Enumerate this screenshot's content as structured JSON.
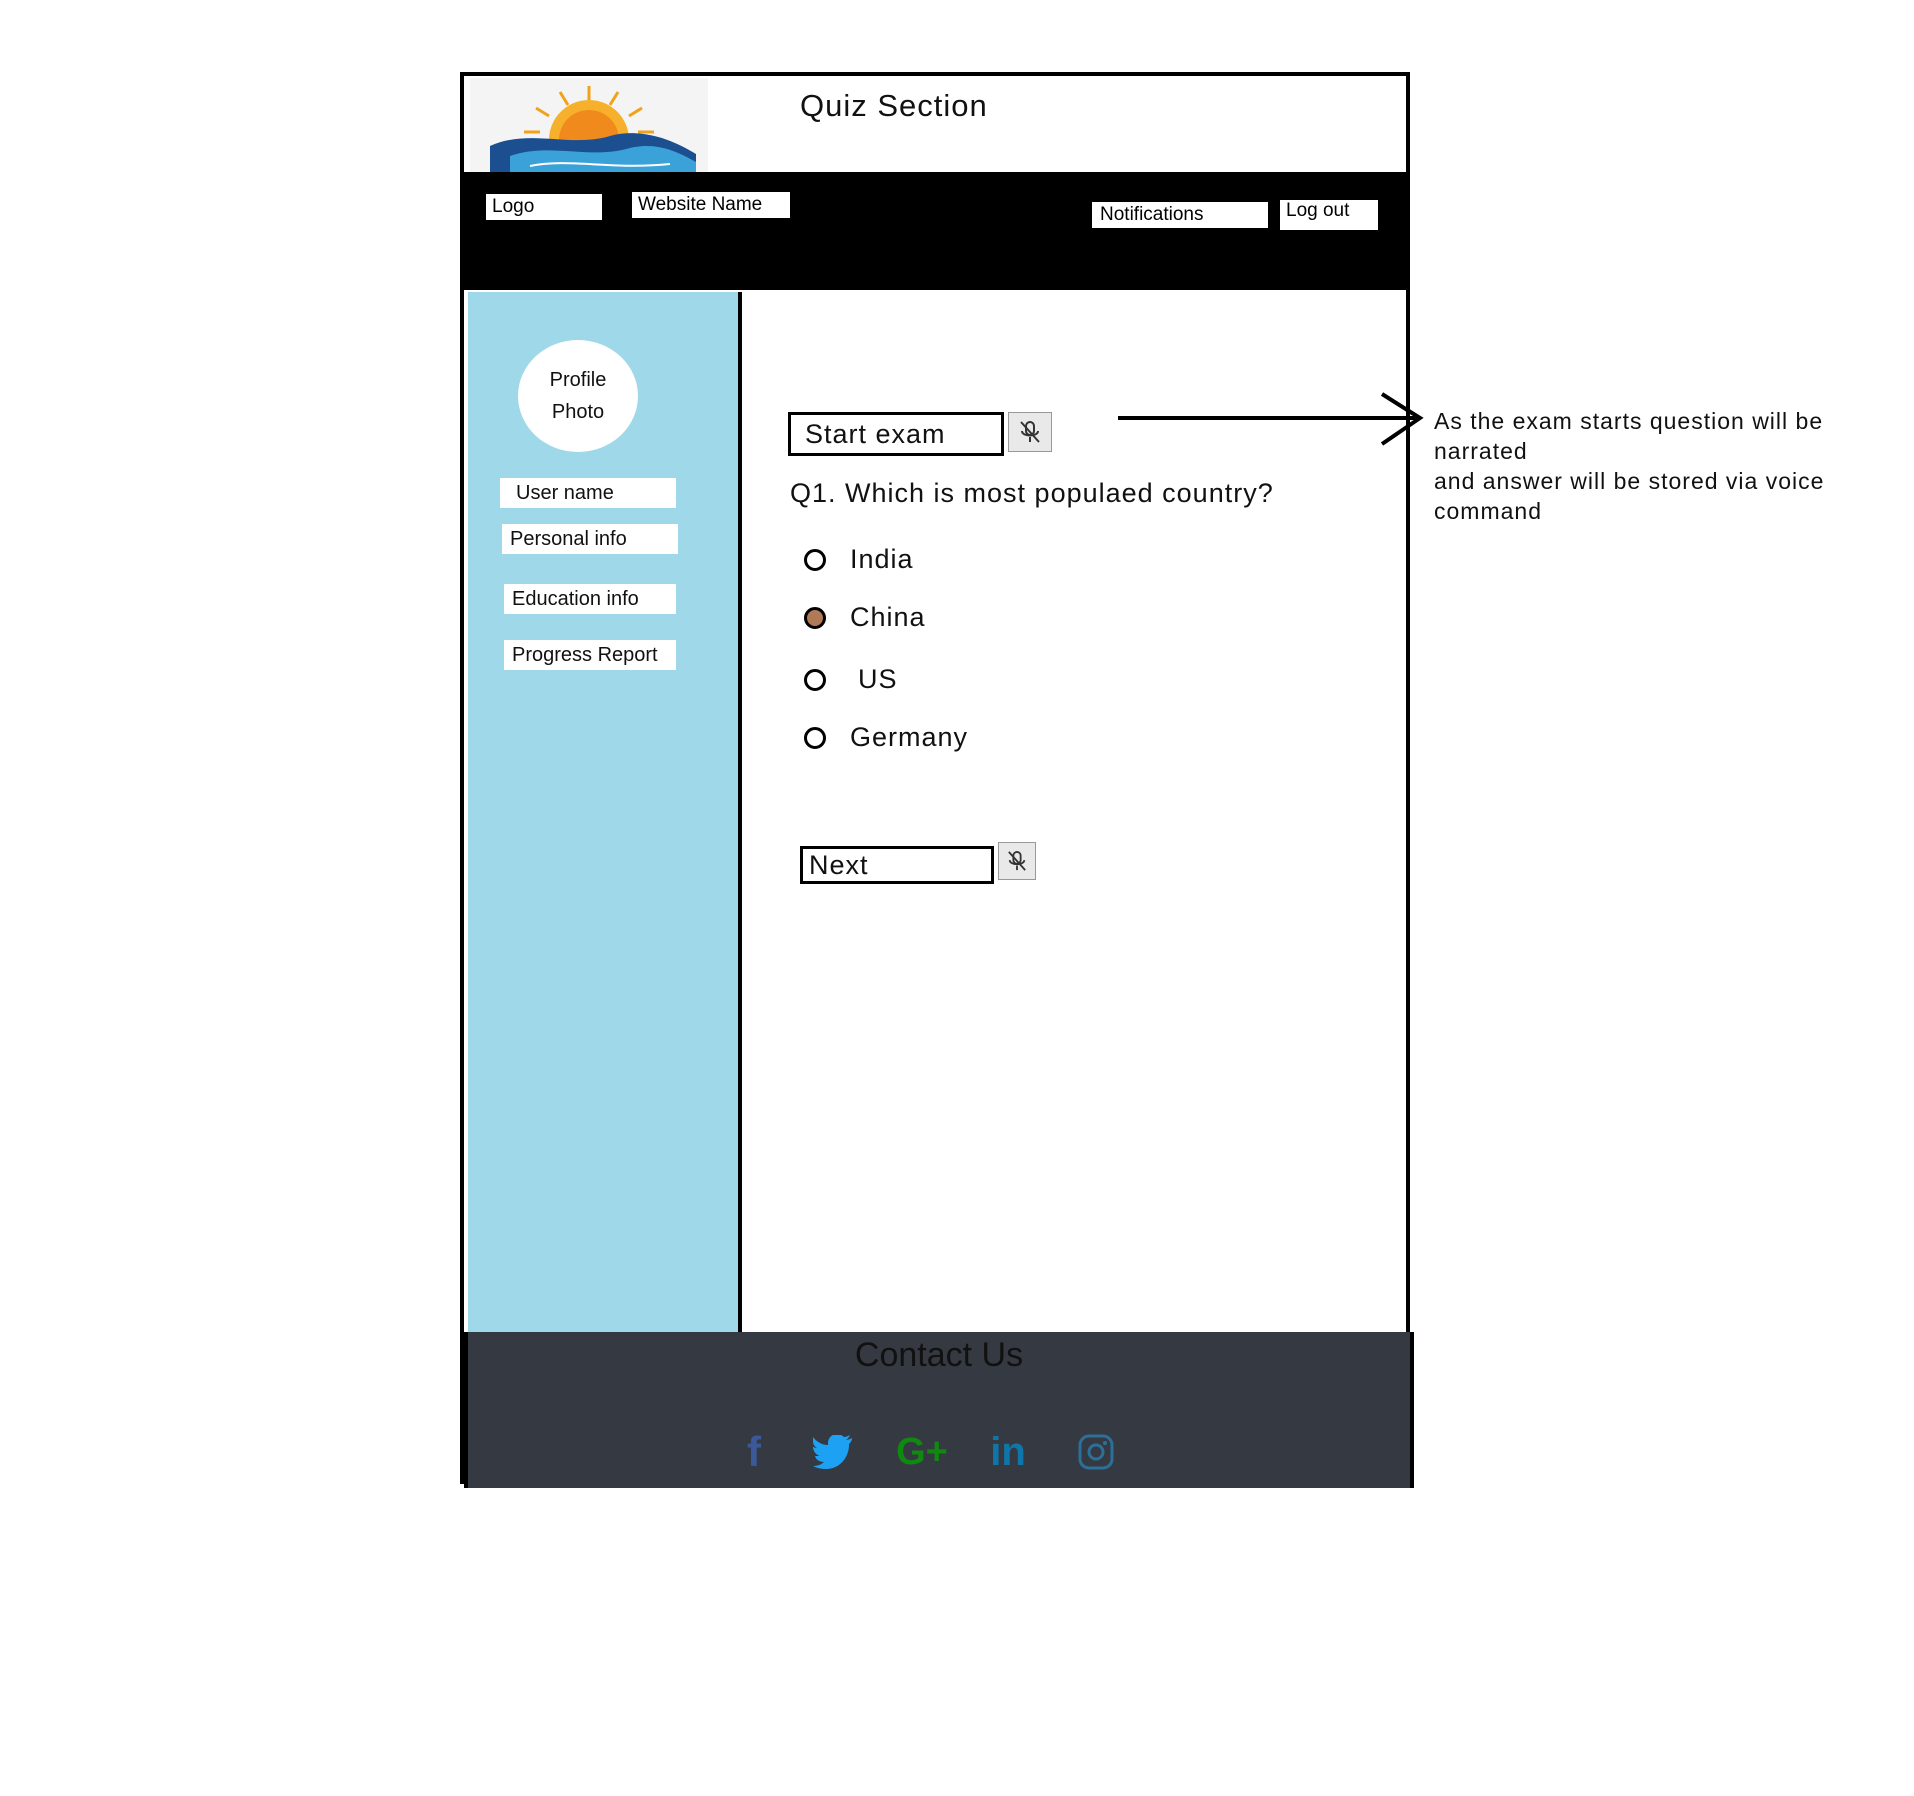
{
  "header": {
    "page_title": "Quiz Section",
    "logo_label": "Logo",
    "website_name_label": "Website Name",
    "notifications_label": "Notifications",
    "logout_label": "Log out"
  },
  "sidebar": {
    "avatar_label_line1": "Profile",
    "avatar_label_line2": "Photo",
    "items": [
      {
        "label": "User name"
      },
      {
        "label": "Personal info"
      },
      {
        "label": "Education info"
      },
      {
        "label": "Progress Report"
      }
    ]
  },
  "quiz": {
    "start_label": "Start exam",
    "question": "Q1. Which is most populaed country?",
    "options": [
      {
        "label": "India",
        "selected": false
      },
      {
        "label": "China",
        "selected": true
      },
      {
        "label": "US",
        "selected": false
      },
      {
        "label": "Germany",
        "selected": false
      }
    ],
    "next_label": "Next",
    "mic_icon": "mic-off-icon"
  },
  "footer": {
    "title": "Contact Us",
    "social": [
      {
        "icon": "facebook-icon",
        "color": "#3b5998"
      },
      {
        "icon": "twitter-icon",
        "color": "#1da1f2"
      },
      {
        "icon": "google-plus-icon",
        "color": "#0f8a0f"
      },
      {
        "icon": "linkedin-icon",
        "color": "#0e76a8"
      },
      {
        "icon": "instagram-icon",
        "color": "#2c6f99"
      }
    ]
  },
  "annotation": {
    "line1": "As the exam starts question will be",
    "line2": "narrated",
    "line3": "and answer will be stored via voice",
    "line4": "command"
  },
  "colors": {
    "sidebar_bg": "#9fd9e9",
    "footer_bg": "#353a42",
    "selected_radio": "#b07a56"
  }
}
